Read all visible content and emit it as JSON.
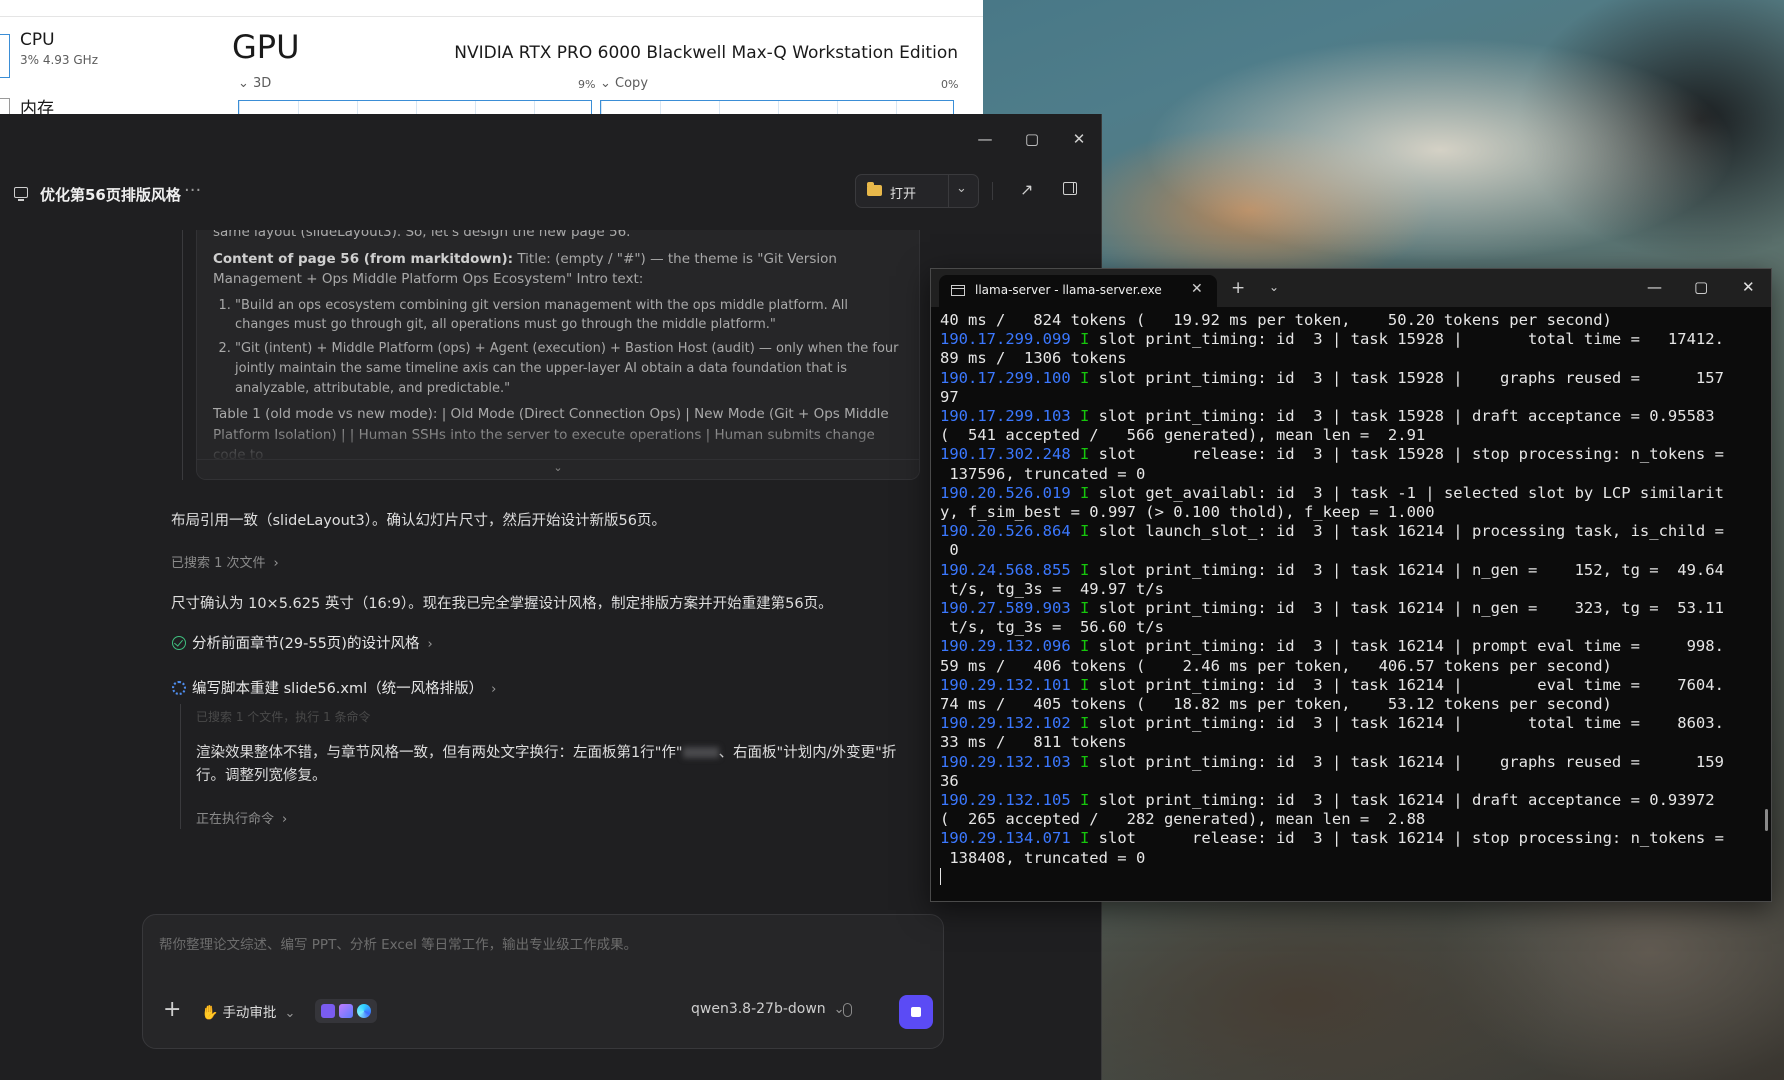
{
  "task_manager": {
    "cpu_label": "CPU",
    "cpu_sub": "3% 4.93 GHz",
    "mem_label": "内存",
    "gpu_title": "GPU",
    "gpu_name": "NVIDIA RTX PRO 6000 Blackwell Max-Q Workstation Edition",
    "engine_3d": "3D",
    "engine_3d_pct": "9%",
    "engine_copy": "Copy",
    "engine_copy_pct": "0%"
  },
  "chat": {
    "title": "优化第56页排版风格",
    "more": "···",
    "open_label": "打开",
    "think": {
      "cut_line": "same layout (slideLayout3). So, let's design the new page 56.",
      "content_label": "Content of page 56 (from markitdown):",
      "content_text": " Title: (empty / \"#\") — the theme is \"Git Version Management + Ops Middle Platform Ops Ecosystem\" Intro text:",
      "items": [
        "\"Build an ops ecosystem combining git version management with the ops middle platform. All changes must go through git, all operations must go through the middle platform.\"",
        "\"Git (intent) + Middle Platform (ops) + Agent (execution) + Bastion Host (audit) — only when the four jointly maintain the same timeline axis can the upper-layer AI obtain a data foundation that is analyzable, attributable, and predictable.\""
      ],
      "table_text": "Table 1 (old mode vs new mode): | Old Mode (Direct Connection Ops) | New Mode (Git + Ops Middle Platform Isolation) | | Human SSHs into the server to execute operations | Human submits change code to",
      "expand": "⌄"
    },
    "msg1": "布局引用一致（slideLayout3）。确认幻灯片尺寸，然后开始设计新版56页。",
    "searched": "已搜索 1 次文件",
    "msg2": "尺寸确认为 10×5.625 英寸（16:9）。现在我已完全掌握设计风格，制定排版方案并开始重建第56页。",
    "step1": "分析前面章节(29-55页)的设计风格",
    "step2": "编写脚本重建 slide56.xml（统一风格排版）",
    "step_ghost": "已搜索 1 个文件，执行 1 条命令",
    "msg3_a": "渲染效果整体不错，与章节风格一致，但有两处文字换行：左面板第1行\"作\"",
    "msg3_b": "、右面板\"计划内/外变更\"折",
    "msg3_c": "行。调整列宽修复。",
    "running": "正在执行命令",
    "placeholder": "帮你整理论文综述、编写 PPT、分析 Excel 等日常工作，输出专业级工作成果。",
    "approve": "手动审批",
    "model": "qwen3.8-27b-down"
  },
  "terminal": {
    "tab_title": "llama-server - llama-server.exe",
    "lines": [
      {
        "ts": "",
        "lv": "",
        "text": "40 ms /   824 tokens (   19.92 ms per token,    50.20 tokens per second)"
      },
      {
        "ts": "190.17.299.099",
        "lv": "I",
        "text": " slot print_timing: id  3 | task 15928 |       total time =   17412."
      },
      {
        "ts": "",
        "lv": "",
        "text": "89 ms /  1306 tokens"
      },
      {
        "ts": "190.17.299.100",
        "lv": "I",
        "text": " slot print_timing: id  3 | task 15928 |    graphs reused =      157"
      },
      {
        "ts": "",
        "lv": "",
        "text": "97"
      },
      {
        "ts": "190.17.299.103",
        "lv": "I",
        "text": " slot print_timing: id  3 | task 15928 | draft acceptance = 0.95583"
      },
      {
        "ts": "",
        "lv": "",
        "text": "(  541 accepted /   566 generated), mean len =  2.91"
      },
      {
        "ts": "190.17.302.248",
        "lv": "I",
        "text": " slot      release: id  3 | task 15928 | stop processing: n_tokens ="
      },
      {
        "ts": "",
        "lv": "",
        "text": " 137596, truncated = 0"
      },
      {
        "ts": "190.20.526.019",
        "lv": "I",
        "text": " slot get_availabl: id  3 | task -1 | selected slot by LCP similarit"
      },
      {
        "ts": "",
        "lv": "",
        "text": "y, f_sim_best = 0.997 (> 0.100 thold), f_keep = 1.000"
      },
      {
        "ts": "190.20.526.864",
        "lv": "I",
        "text": " slot launch_slot_: id  3 | task 16214 | processing task, is_child ="
      },
      {
        "ts": "",
        "lv": "",
        "text": " 0"
      },
      {
        "ts": "190.24.568.855",
        "lv": "I",
        "text": " slot print_timing: id  3 | task 16214 | n_gen =    152, tg =  49.64"
      },
      {
        "ts": "",
        "lv": "",
        "text": " t/s, tg_3s =  49.97 t/s"
      },
      {
        "ts": "190.27.589.903",
        "lv": "I",
        "text": " slot print_timing: id  3 | task 16214 | n_gen =    323, tg =  53.11"
      },
      {
        "ts": "",
        "lv": "",
        "text": " t/s, tg_3s =  56.60 t/s"
      },
      {
        "ts": "190.29.132.096",
        "lv": "I",
        "text": " slot print_timing: id  3 | task 16214 | prompt eval time =     998."
      },
      {
        "ts": "",
        "lv": "",
        "text": "59 ms /   406 tokens (    2.46 ms per token,   406.57 tokens per second)"
      },
      {
        "ts": "190.29.132.101",
        "lv": "I",
        "text": " slot print_timing: id  3 | task 16214 |        eval time =    7604."
      },
      {
        "ts": "",
        "lv": "",
        "text": "74 ms /   405 tokens (   18.82 ms per token,    53.12 tokens per second)"
      },
      {
        "ts": "190.29.132.102",
        "lv": "I",
        "text": " slot print_timing: id  3 | task 16214 |       total time =    8603."
      },
      {
        "ts": "",
        "lv": "",
        "text": "33 ms /   811 tokens"
      },
      {
        "ts": "190.29.132.103",
        "lv": "I",
        "text": " slot print_timing: id  3 | task 16214 |    graphs reused =      159"
      },
      {
        "ts": "",
        "lv": "",
        "text": "36"
      },
      {
        "ts": "190.29.132.105",
        "lv": "I",
        "text": " slot print_timing: id  3 | task 16214 | draft acceptance = 0.93972"
      },
      {
        "ts": "",
        "lv": "",
        "text": "(  265 accepted /   282 generated), mean len =  2.88"
      },
      {
        "ts": "190.29.134.071",
        "lv": "I",
        "text": " slot      release: id  3 | task 16214 | stop processing: n_tokens ="
      },
      {
        "ts": "",
        "lv": "",
        "text": " 138408, truncated = 0"
      }
    ]
  },
  "colors": {
    "accent": "#5b4bf5",
    "success": "#3fbf7f",
    "timestamp": "#3b78ff",
    "log_level": "#16c60c"
  }
}
